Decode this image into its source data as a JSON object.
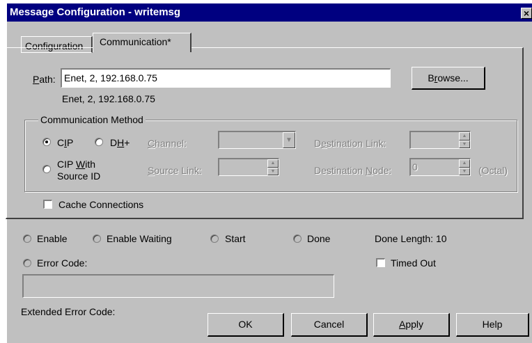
{
  "window": {
    "title": "Message Configuration - writemsg",
    "close_glyph": "×"
  },
  "tabs": [
    {
      "label": "Configuration"
    },
    {
      "label": "Communication*"
    }
  ],
  "path": {
    "label": "Path:",
    "value": "Enet, 2, 192.168.0.75",
    "resolved": "Enet, 2, 192.168.0.75",
    "browse_label": "Browse..."
  },
  "comm_method": {
    "title": "Communication Method",
    "cip": "CIP",
    "dhplus": "DH+",
    "cip_with_source_1": "CIP With",
    "cip_with_source_2": "Source ID",
    "channel_label": "Channel:",
    "source_link_label": "Source Link:",
    "destination_link_label": "Destination Link:",
    "destination_node_label": "Destination Node:",
    "destination_node_value": "0",
    "octal_label": "(Octal)"
  },
  "cache_connections": "Cache Connections",
  "status": {
    "enable": "Enable",
    "enable_waiting": "Enable Waiting",
    "start": "Start",
    "done": "Done",
    "done_length": "Done Length: 10",
    "error_code": "Error Code:",
    "timed_out": "Timed Out",
    "extended_error_code": "Extended Error Code:",
    "error_text": ""
  },
  "buttons": {
    "ok": "OK",
    "cancel": "Cancel",
    "apply": "Apply",
    "help": "Help"
  }
}
